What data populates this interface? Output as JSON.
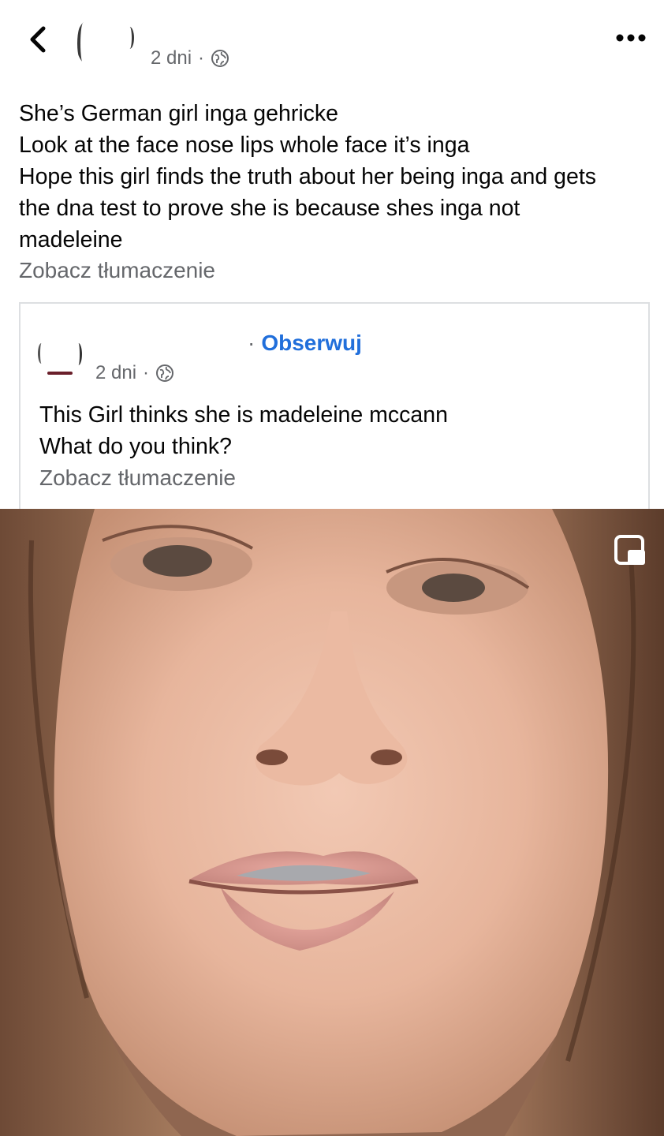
{
  "header": {
    "timestamp": "2 dni",
    "separator": "·",
    "back_icon": "chevron-left-icon",
    "more_icon": "ellipsis-icon",
    "privacy_icon": "globe-icon"
  },
  "post": {
    "lines": [
      "She’s German girl inga gehricke",
      "Look at the face nose lips whole face it’s inga",
      "Hope this girl finds the truth about her being inga and gets",
      "the dna test to prove she is because shes inga not",
      "madeleine"
    ],
    "translate_label": "Zobacz tłumaczenie"
  },
  "shared": {
    "separator": "·",
    "follow_label": "Obserwuj",
    "timestamp": "2 dni",
    "lines": [
      "This Girl thinks she is madeleine mccann",
      "What do you think?"
    ],
    "translate_label": "Zobacz tłumaczenie"
  },
  "video": {
    "pip_icon": "picture-in-picture-icon"
  },
  "colors": {
    "text": "#050505",
    "secondary": "#65676b",
    "link": "#216fdb",
    "card_border": "#dddfe2"
  }
}
